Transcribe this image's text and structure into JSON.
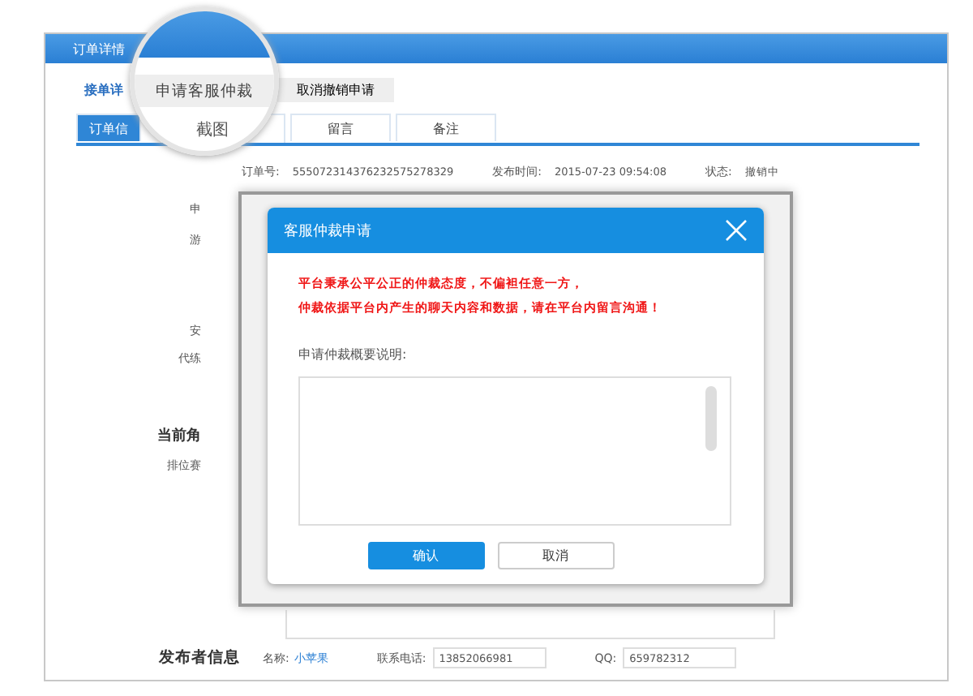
{
  "window": {
    "title": "订单详情"
  },
  "actions": [
    {
      "label": "接单详",
      "kind": "link"
    },
    {
      "label": "取消撤销申请",
      "kind": "button"
    }
  ],
  "magnifier": {
    "button": "申请客服仲裁",
    "tab": "截图"
  },
  "tabs": [
    {
      "label": "订单信",
      "selected": true
    },
    {
      "label": "留言",
      "selected": false
    },
    {
      "label": "备注",
      "selected": false
    }
  ],
  "order_info": [
    {
      "label": "订单号:",
      "value": "555072314376232575278329"
    },
    {
      "label": "发布时间:",
      "value": "2015-07-23 09:54:08"
    },
    {
      "label": "状态:",
      "value": "撤销中"
    }
  ],
  "side_labels": [
    {
      "text": "申",
      "kind": "field"
    },
    {
      "text": "游",
      "kind": "field"
    },
    {
      "text": "安",
      "kind": "field"
    },
    {
      "text": "代练",
      "kind": "field"
    },
    {
      "text": "当前角",
      "kind": "heading"
    },
    {
      "text": "排位赛",
      "kind": "field"
    }
  ],
  "dialog": {
    "title": "客服仲裁申请",
    "notice": [
      "平台秉承公平公正的仲裁态度，不偏袒任意一方，",
      "仲裁依据平台内产生的聊天内容和数据，请在平台内留言沟通！"
    ],
    "field_label": "申请仲裁概要说明:",
    "buttons": [
      {
        "label": "确认",
        "kind": "primary"
      },
      {
        "label": "取消",
        "kind": "secondary"
      }
    ]
  },
  "publisher": {
    "heading": "发布者信息",
    "name_label": "名称:",
    "name": "小苹果",
    "phone_label": "联系电话:",
    "phone": "13852066981",
    "qq_label": "QQ:",
    "qq": "659782312"
  }
}
